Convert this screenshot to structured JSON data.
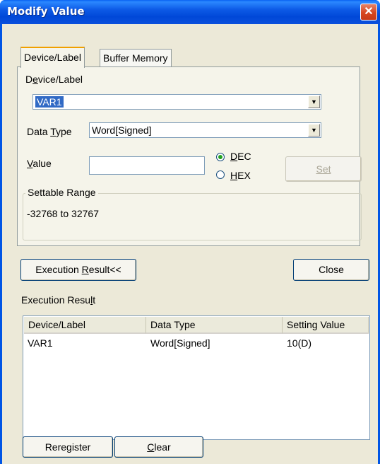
{
  "window": {
    "title": "Modify Value",
    "close_glyph": "✕"
  },
  "tabs": [
    {
      "label": "Device/Label"
    },
    {
      "label": "Buffer Memory"
    }
  ],
  "device_label": {
    "label": "Device/Label",
    "value": "VAR1"
  },
  "data_type": {
    "label": "Data Type",
    "value": "Word[Signed]"
  },
  "value_field": {
    "label": "Value",
    "value": ""
  },
  "radix": {
    "dec": "DEC",
    "hex": "HEX",
    "selected": "DEC"
  },
  "buttons": {
    "set": "Set",
    "execution_result": "Execution Result<<",
    "close": "Close",
    "reregister": "Reregister",
    "clear": "Clear"
  },
  "settable_range": {
    "legend": "Settable Range",
    "text": "-32768 to 32767"
  },
  "execution_result": {
    "label": "Execution Result",
    "columns": [
      "Device/Label",
      "Data Type",
      "Setting Value"
    ],
    "rows": [
      {
        "device": "VAR1",
        "type": "Word[Signed]",
        "value": "10(D)"
      }
    ]
  },
  "icons": {
    "dropdown": "▼"
  }
}
